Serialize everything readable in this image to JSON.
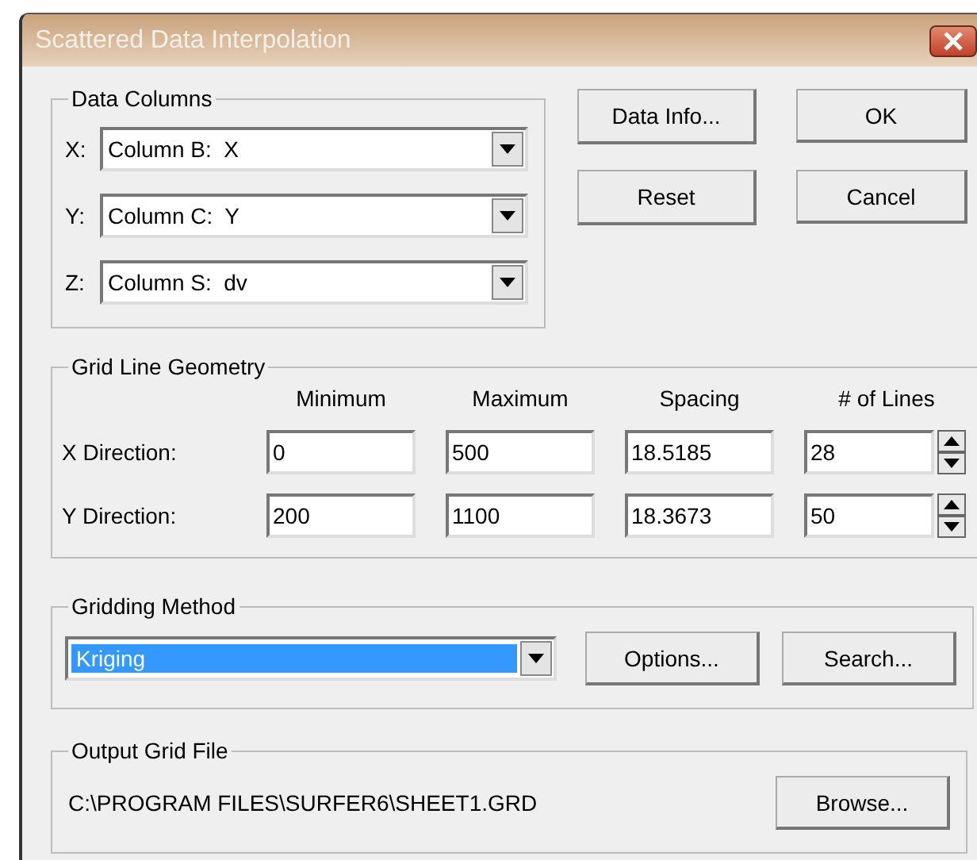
{
  "window": {
    "title": "Scattered Data Interpolation"
  },
  "data_columns": {
    "label": "Data Columns",
    "fields": [
      {
        "label": "X:",
        "value": "Column B:  X"
      },
      {
        "label": "Y:",
        "value": "Column C:  Y"
      },
      {
        "label": "Z:",
        "value": "Column S:  dv"
      }
    ]
  },
  "buttons": [
    {
      "label": "Data Info..."
    },
    {
      "label": "OK"
    },
    {
      "label": "Reset"
    },
    {
      "label": "Cancel"
    }
  ],
  "grid_geometry": {
    "label": "Grid Line Geometry",
    "columns": [
      "Minimum",
      "Maximum",
      "Spacing",
      "# of Lines"
    ],
    "rows": [
      {
        "label": "X Direction:",
        "minimum": "0",
        "maximum": "500",
        "spacing": "18.5185",
        "lines": "28"
      },
      {
        "label": "Y Direction:",
        "minimum": "200",
        "maximum": "1100",
        "spacing": "18.3673",
        "lines": "50"
      }
    ]
  },
  "gridding_method": {
    "label": "Gridding Method",
    "value": "Kriging",
    "selected": true,
    "buttons": [
      {
        "label": "Options..."
      },
      {
        "label": "Search..."
      }
    ]
  },
  "output_grid_file": {
    "label": "Output Grid File",
    "path": "C:\\PROGRAM FILES\\SURFER6\\SHEET1.GRD",
    "button": {
      "label": "Browse..."
    }
  }
}
